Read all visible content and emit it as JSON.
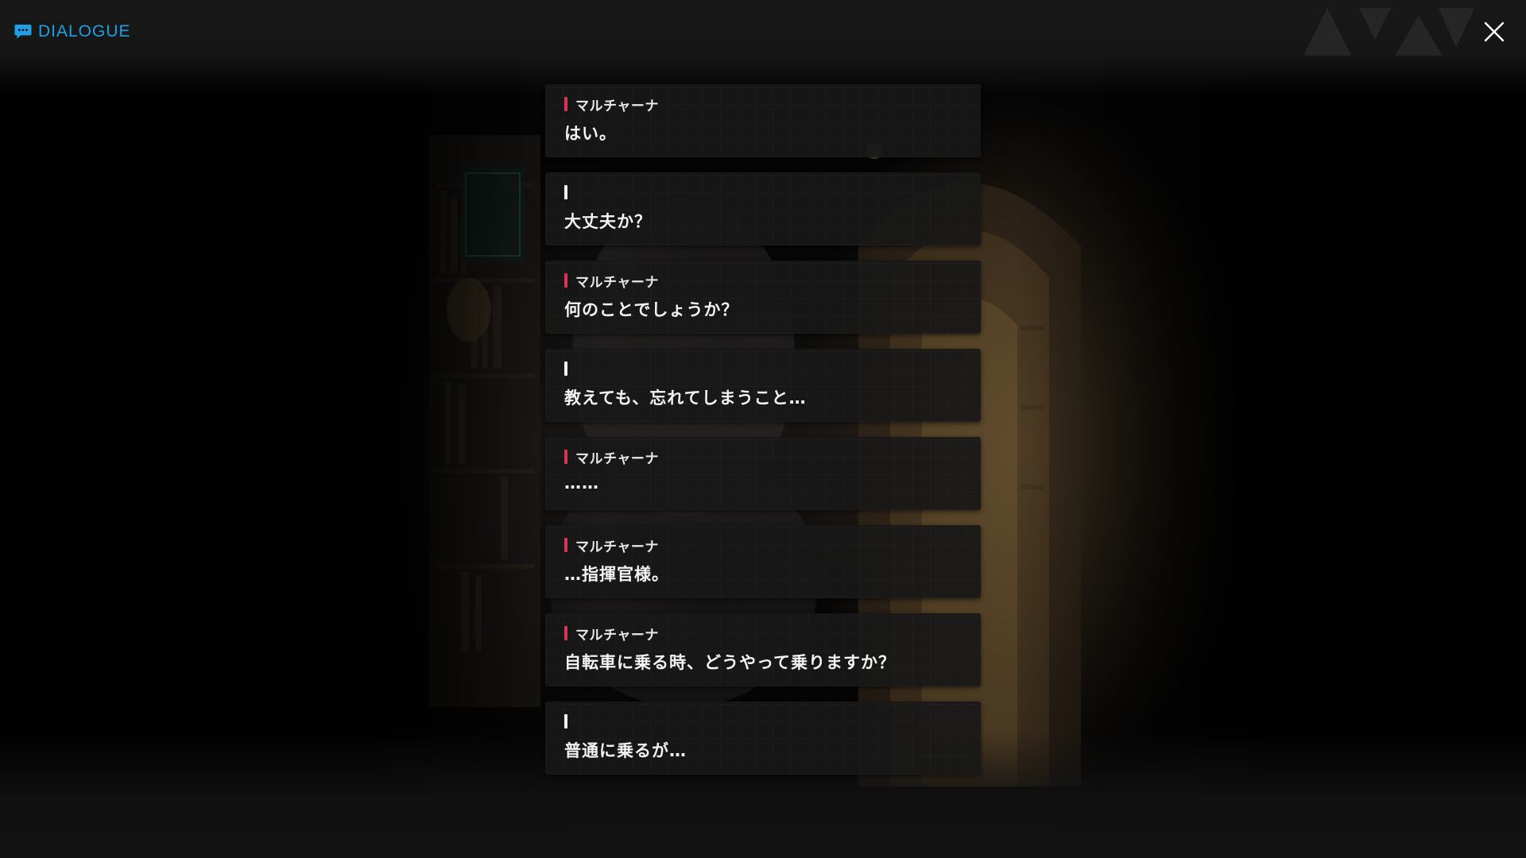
{
  "header": {
    "title": "DIALOGUE",
    "accent_color": "#1fa0e6",
    "icon": "chat-bubble-icon"
  },
  "close": {
    "icon": "close-icon"
  },
  "speaker_colors": {
    "character": "#d93556",
    "player": "#f2f2f2"
  },
  "entries": [
    {
      "speaker": "マルチャーナ",
      "speaker_type": "character",
      "text": "はい。"
    },
    {
      "speaker": "",
      "speaker_type": "player",
      "text": "大丈夫か？"
    },
    {
      "speaker": "マルチャーナ",
      "speaker_type": "character",
      "text": "何のことでしょうか？"
    },
    {
      "speaker": "",
      "speaker_type": "player",
      "text": "教えても、忘れてしまうこと…"
    },
    {
      "speaker": "マルチャーナ",
      "speaker_type": "character",
      "text": "……"
    },
    {
      "speaker": "マルチャーナ",
      "speaker_type": "character",
      "text": "…指揮官様。"
    },
    {
      "speaker": "マルチャーナ",
      "speaker_type": "character",
      "text": "自転車に乗る時、どうやって乗りますか？"
    },
    {
      "speaker": "",
      "speaker_type": "player",
      "text": "普通に乗るが…"
    }
  ]
}
